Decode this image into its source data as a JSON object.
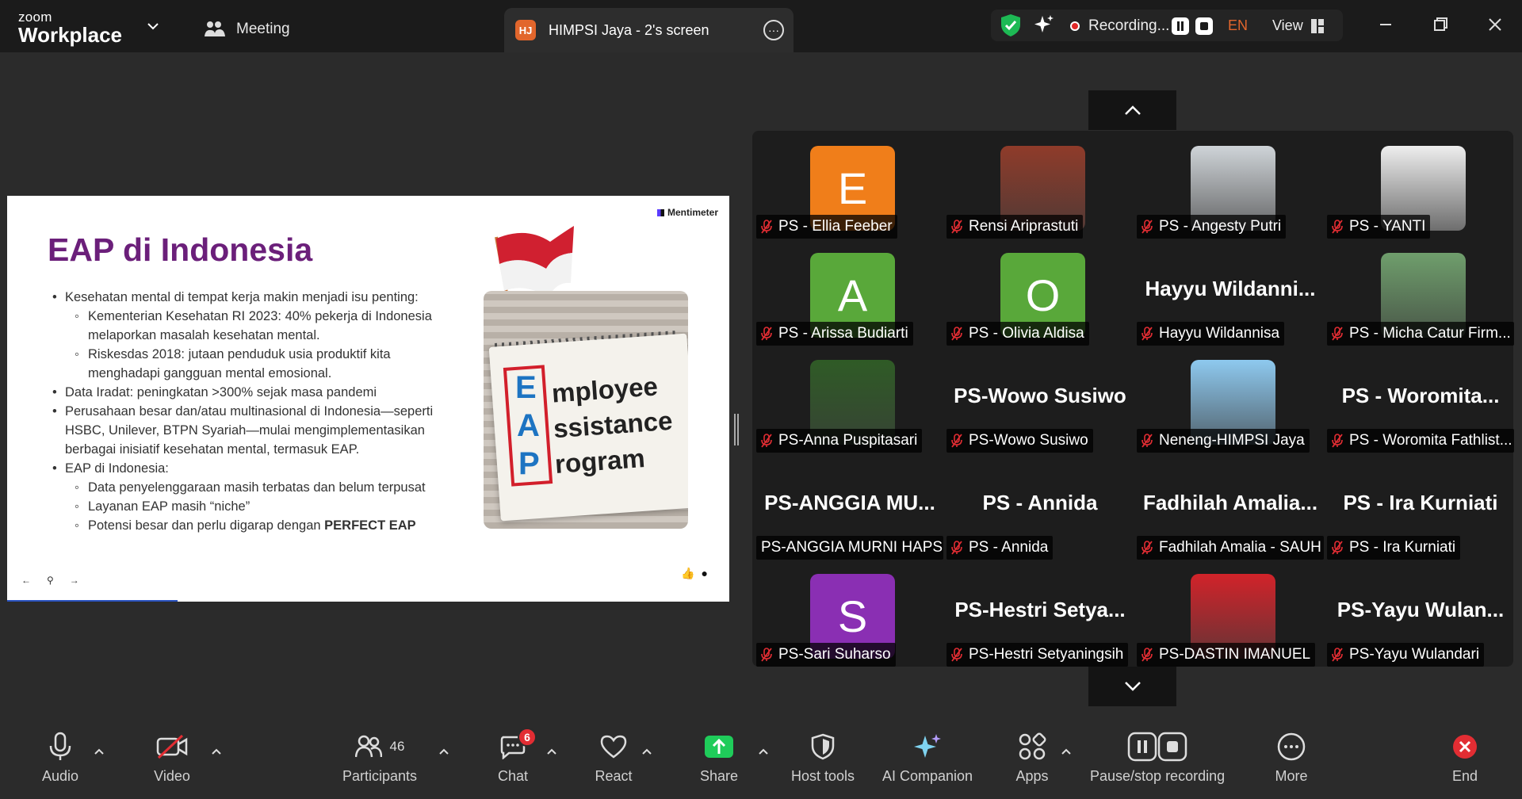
{
  "titlebar": {
    "logo_small": "zoom",
    "logo_big": "Workplace",
    "meeting_label": "Meeting",
    "share_tab_badge": "HJ",
    "share_tab_title": "HIMPSI Jaya - 2's screen",
    "recording_label": "Recording...",
    "language": "EN",
    "view_label": "View"
  },
  "slide": {
    "brand": "Mentimeter",
    "title": "EAP di Indonesia",
    "bullets": [
      {
        "level": 1,
        "text": "Kesehatan mental di tempat kerja makin menjadi isu penting:"
      },
      {
        "level": 2,
        "text": "Kementerian Kesehatan RI 2023: 40% pekerja di Indonesia melaporkan masalah kesehatan mental."
      },
      {
        "level": 2,
        "text": "Riskesdas 2018: jutaan penduduk usia produktif kita menghadapi gangguan mental emosional."
      },
      {
        "level": 1,
        "text": "Data Iradat: peningkatan >300% sejak masa pandemi"
      },
      {
        "level": 1,
        "text": "Perusahaan besar dan/atau multinasional di Indonesia—seperti HSBC, Unilever, BTPN Syariah—mulai mengimplementasikan berbagai inisiatif kesehatan mental, termasuk EAP."
      },
      {
        "level": 1,
        "text": "EAP di Indonesia:"
      },
      {
        "level": 2,
        "text": "Data penyelenggaraan masih terbatas dan belum terpusat"
      },
      {
        "level": 2,
        "text": "Layanan EAP masih “niche”"
      }
    ],
    "last_bullet_prefix": "Potensi besar dan perlu digarap dengan ",
    "last_bullet_bold": "PERFECT EAP",
    "image_words": {
      "l1": "E",
      "l2": "A",
      "l3": "P",
      "w1": "mployee",
      "w2": "ssistance",
      "w3": "rogram"
    }
  },
  "gallery": {
    "tiles": [
      {
        "name": "PS - Ellia Feeber",
        "type": "letter",
        "letter": "E",
        "color": "#f07e1a",
        "muted": true
      },
      {
        "name": "Rensi Ariprastuti",
        "type": "photo",
        "color": "#8f3b2a",
        "muted": true
      },
      {
        "name": "PS - Angesty Putri",
        "type": "photo",
        "color": "#cfd4d8",
        "muted": true
      },
      {
        "name": "PS - YANTI",
        "type": "photo",
        "color": "#eeeeee",
        "muted": true
      },
      {
        "name": "PS - Arissa Budiarti",
        "type": "letter",
        "letter": "A",
        "color": "#59a83a",
        "muted": true
      },
      {
        "name": "PS - Olivia Aldisa",
        "type": "letter",
        "letter": "O",
        "color": "#59a83a",
        "muted": true
      },
      {
        "name": "Hayyu Wildannisa",
        "type": "text",
        "big": "Hayyu  Wildanni...",
        "muted": true
      },
      {
        "name": "PS - Micha Catur Firm...",
        "type": "photo",
        "color": "#6f9e6c",
        "muted": true
      },
      {
        "name": "PS-Anna Puspitasari",
        "type": "photo",
        "color": "#2f5b26",
        "muted": true
      },
      {
        "name": "PS-Wowo Susiwo",
        "type": "text",
        "big": "PS-Wowo Susiwo",
        "muted": true
      },
      {
        "name": "Neneng-HIMPSI Jaya",
        "type": "photo",
        "color": "#8ec9ef",
        "muted": true
      },
      {
        "name": "PS - Woromita Fathlist...",
        "type": "text",
        "big": "PS  -  Woromita...",
        "muted": true
      },
      {
        "name": "PS-ANGGIA MURNI HAPS...",
        "type": "text",
        "big": "PS-ANGGIA  MU...",
        "muted": false
      },
      {
        "name": "PS - Annida",
        "type": "text",
        "big": "PS - Annida",
        "muted": true
      },
      {
        "name": "Fadhilah Amalia - SAUH",
        "type": "text",
        "big": "Fadhilah  Amalia...",
        "muted": true
      },
      {
        "name": "PS - Ira Kurniati",
        "type": "text",
        "big": "PS - Ira Kurniati",
        "muted": true
      },
      {
        "name": "PS-Sari Suharso",
        "type": "letter",
        "letter": "S",
        "color": "#8a2fb3",
        "muted": true
      },
      {
        "name": "PS-Hestri Setyaningsih",
        "type": "text",
        "big": "PS-Hestri  Setya...",
        "muted": true
      },
      {
        "name": "PS-DASTIN IMANUEL",
        "type": "photo",
        "color": "#d2232a",
        "muted": true
      },
      {
        "name": "PS-Yayu Wulandari",
        "type": "text",
        "big": "PS-Yayu  Wulan...",
        "muted": true
      }
    ]
  },
  "toolbar": {
    "audio": "Audio",
    "video": "Video",
    "participants": "Participants",
    "participants_count": "46",
    "chat": "Chat",
    "chat_badge": "6",
    "react": "React",
    "share": "Share",
    "host_tools": "Host tools",
    "ai_companion": "AI Companion",
    "apps": "Apps",
    "pause_recording": "Pause/stop recording",
    "more": "More",
    "end": "End"
  },
  "colors": {
    "accent_green": "#1db954",
    "record_red": "#e02828",
    "title_purple": "#6b1f7a"
  }
}
